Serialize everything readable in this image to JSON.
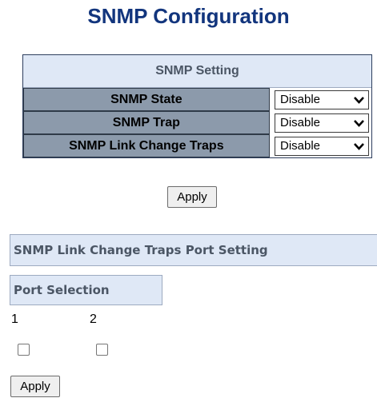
{
  "page": {
    "title": "SNMP Configuration"
  },
  "snmp_setting": {
    "header": "SNMP Setting",
    "rows": [
      {
        "label": "SNMP State",
        "value": "Disable"
      },
      {
        "label": "SNMP Trap",
        "value": "Disable"
      },
      {
        "label": "SNMP Link Change Traps",
        "value": "Disable"
      }
    ],
    "apply_label": "Apply"
  },
  "port_setting": {
    "header": "SNMP Link Change Traps Port Setting",
    "selection_label": "Port Selection",
    "ports": [
      {
        "number": "1",
        "checked": false
      },
      {
        "number": "2",
        "checked": false
      }
    ],
    "apply_label": "Apply"
  },
  "colors": {
    "title": "#12357d",
    "header_bg": "#dfe8f6",
    "label_bg": "#8c9aab"
  },
  "icons": {
    "dropdown": "chevron-down-icon"
  }
}
